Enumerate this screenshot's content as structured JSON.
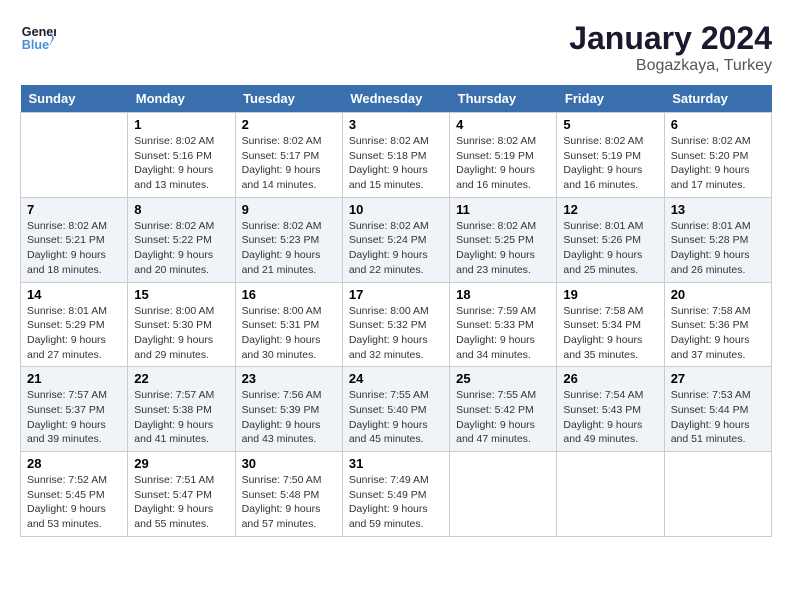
{
  "header": {
    "logo_line1": "General",
    "logo_line2": "Blue",
    "month": "January 2024",
    "location": "Bogazkaya, Turkey"
  },
  "weekdays": [
    "Sunday",
    "Monday",
    "Tuesday",
    "Wednesday",
    "Thursday",
    "Friday",
    "Saturday"
  ],
  "weeks": [
    [
      {
        "day": "",
        "sunrise": "",
        "sunset": "",
        "daylight": ""
      },
      {
        "day": "1",
        "sunrise": "Sunrise: 8:02 AM",
        "sunset": "Sunset: 5:16 PM",
        "daylight": "Daylight: 9 hours and 13 minutes."
      },
      {
        "day": "2",
        "sunrise": "Sunrise: 8:02 AM",
        "sunset": "Sunset: 5:17 PM",
        "daylight": "Daylight: 9 hours and 14 minutes."
      },
      {
        "day": "3",
        "sunrise": "Sunrise: 8:02 AM",
        "sunset": "Sunset: 5:18 PM",
        "daylight": "Daylight: 9 hours and 15 minutes."
      },
      {
        "day": "4",
        "sunrise": "Sunrise: 8:02 AM",
        "sunset": "Sunset: 5:19 PM",
        "daylight": "Daylight: 9 hours and 16 minutes."
      },
      {
        "day": "5",
        "sunrise": "Sunrise: 8:02 AM",
        "sunset": "Sunset: 5:19 PM",
        "daylight": "Daylight: 9 hours and 16 minutes."
      },
      {
        "day": "6",
        "sunrise": "Sunrise: 8:02 AM",
        "sunset": "Sunset: 5:20 PM",
        "daylight": "Daylight: 9 hours and 17 minutes."
      }
    ],
    [
      {
        "day": "7",
        "sunrise": "Sunrise: 8:02 AM",
        "sunset": "Sunset: 5:21 PM",
        "daylight": "Daylight: 9 hours and 18 minutes."
      },
      {
        "day": "8",
        "sunrise": "Sunrise: 8:02 AM",
        "sunset": "Sunset: 5:22 PM",
        "daylight": "Daylight: 9 hours and 20 minutes."
      },
      {
        "day": "9",
        "sunrise": "Sunrise: 8:02 AM",
        "sunset": "Sunset: 5:23 PM",
        "daylight": "Daylight: 9 hours and 21 minutes."
      },
      {
        "day": "10",
        "sunrise": "Sunrise: 8:02 AM",
        "sunset": "Sunset: 5:24 PM",
        "daylight": "Daylight: 9 hours and 22 minutes."
      },
      {
        "day": "11",
        "sunrise": "Sunrise: 8:02 AM",
        "sunset": "Sunset: 5:25 PM",
        "daylight": "Daylight: 9 hours and 23 minutes."
      },
      {
        "day": "12",
        "sunrise": "Sunrise: 8:01 AM",
        "sunset": "Sunset: 5:26 PM",
        "daylight": "Daylight: 9 hours and 25 minutes."
      },
      {
        "day": "13",
        "sunrise": "Sunrise: 8:01 AM",
        "sunset": "Sunset: 5:28 PM",
        "daylight": "Daylight: 9 hours and 26 minutes."
      }
    ],
    [
      {
        "day": "14",
        "sunrise": "Sunrise: 8:01 AM",
        "sunset": "Sunset: 5:29 PM",
        "daylight": "Daylight: 9 hours and 27 minutes."
      },
      {
        "day": "15",
        "sunrise": "Sunrise: 8:00 AM",
        "sunset": "Sunset: 5:30 PM",
        "daylight": "Daylight: 9 hours and 29 minutes."
      },
      {
        "day": "16",
        "sunrise": "Sunrise: 8:00 AM",
        "sunset": "Sunset: 5:31 PM",
        "daylight": "Daylight: 9 hours and 30 minutes."
      },
      {
        "day": "17",
        "sunrise": "Sunrise: 8:00 AM",
        "sunset": "Sunset: 5:32 PM",
        "daylight": "Daylight: 9 hours and 32 minutes."
      },
      {
        "day": "18",
        "sunrise": "Sunrise: 7:59 AM",
        "sunset": "Sunset: 5:33 PM",
        "daylight": "Daylight: 9 hours and 34 minutes."
      },
      {
        "day": "19",
        "sunrise": "Sunrise: 7:58 AM",
        "sunset": "Sunset: 5:34 PM",
        "daylight": "Daylight: 9 hours and 35 minutes."
      },
      {
        "day": "20",
        "sunrise": "Sunrise: 7:58 AM",
        "sunset": "Sunset: 5:36 PM",
        "daylight": "Daylight: 9 hours and 37 minutes."
      }
    ],
    [
      {
        "day": "21",
        "sunrise": "Sunrise: 7:57 AM",
        "sunset": "Sunset: 5:37 PM",
        "daylight": "Daylight: 9 hours and 39 minutes."
      },
      {
        "day": "22",
        "sunrise": "Sunrise: 7:57 AM",
        "sunset": "Sunset: 5:38 PM",
        "daylight": "Daylight: 9 hours and 41 minutes."
      },
      {
        "day": "23",
        "sunrise": "Sunrise: 7:56 AM",
        "sunset": "Sunset: 5:39 PM",
        "daylight": "Daylight: 9 hours and 43 minutes."
      },
      {
        "day": "24",
        "sunrise": "Sunrise: 7:55 AM",
        "sunset": "Sunset: 5:40 PM",
        "daylight": "Daylight: 9 hours and 45 minutes."
      },
      {
        "day": "25",
        "sunrise": "Sunrise: 7:55 AM",
        "sunset": "Sunset: 5:42 PM",
        "daylight": "Daylight: 9 hours and 47 minutes."
      },
      {
        "day": "26",
        "sunrise": "Sunrise: 7:54 AM",
        "sunset": "Sunset: 5:43 PM",
        "daylight": "Daylight: 9 hours and 49 minutes."
      },
      {
        "day": "27",
        "sunrise": "Sunrise: 7:53 AM",
        "sunset": "Sunset: 5:44 PM",
        "daylight": "Daylight: 9 hours and 51 minutes."
      }
    ],
    [
      {
        "day": "28",
        "sunrise": "Sunrise: 7:52 AM",
        "sunset": "Sunset: 5:45 PM",
        "daylight": "Daylight: 9 hours and 53 minutes."
      },
      {
        "day": "29",
        "sunrise": "Sunrise: 7:51 AM",
        "sunset": "Sunset: 5:47 PM",
        "daylight": "Daylight: 9 hours and 55 minutes."
      },
      {
        "day": "30",
        "sunrise": "Sunrise: 7:50 AM",
        "sunset": "Sunset: 5:48 PM",
        "daylight": "Daylight: 9 hours and 57 minutes."
      },
      {
        "day": "31",
        "sunrise": "Sunrise: 7:49 AM",
        "sunset": "Sunset: 5:49 PM",
        "daylight": "Daylight: 9 hours and 59 minutes."
      },
      {
        "day": "",
        "sunrise": "",
        "sunset": "",
        "daylight": ""
      },
      {
        "day": "",
        "sunrise": "",
        "sunset": "",
        "daylight": ""
      },
      {
        "day": "",
        "sunrise": "",
        "sunset": "",
        "daylight": ""
      }
    ]
  ]
}
